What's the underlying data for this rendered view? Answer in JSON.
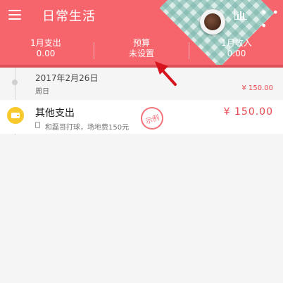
{
  "app": {
    "title": "日常生活"
  },
  "header": {
    "stats": [
      {
        "label": "1月支出",
        "value": "0.00"
      },
      {
        "label": "预算",
        "value": "未设置"
      },
      {
        "label": "1月收入",
        "value": "0.00"
      }
    ],
    "icons": {
      "menu": "menu-icon",
      "chart": "bar-chart-icon",
      "more": "more-icon"
    }
  },
  "day_group": {
    "date": "2017年2月26日",
    "weekday": "周日",
    "total": "¥ 150.00",
    "entries": [
      {
        "title": "其他支出",
        "note": "和磊哥打球，场地费150元",
        "stamp": "示例",
        "amount": "¥ 150.00",
        "icon": "wallet-icon"
      }
    ]
  },
  "colors": {
    "accent": "#f6646c",
    "amount_red": "#e7474f",
    "category_yellow": "#f7c92c"
  }
}
